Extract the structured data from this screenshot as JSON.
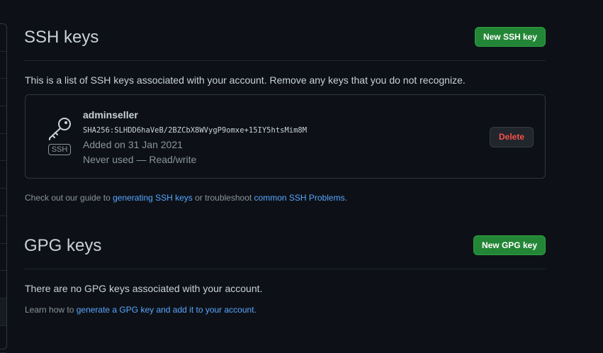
{
  "ssh": {
    "title": "SSH keys",
    "new_button": "New SSH key",
    "description": "This is a list of SSH keys associated with your account. Remove any keys that you do not recognize.",
    "keys": [
      {
        "name": "adminseller",
        "fingerprint": "SHA256:SLHDD6haVeB/2BZCbX8WVygP9omxe+15IY5htsMim8M",
        "added": "Added on 31 Jan 2021",
        "usage": "Never used — Read/write",
        "badge": "SSH",
        "icon": "key-icon",
        "delete_label": "Delete"
      }
    ],
    "guide": {
      "prefix": "Check out our guide to ",
      "link1": "generating SSH keys",
      "middle": " or troubleshoot ",
      "link2": "common SSH Problems",
      "suffix": "."
    }
  },
  "gpg": {
    "title": "GPG keys",
    "new_button": "New GPG key",
    "empty_text": "There are no GPG keys associated with your account.",
    "learn": {
      "prefix": "Learn how to ",
      "link": "generate a GPG key and add it to your account",
      "suffix": "."
    }
  },
  "colors": {
    "background": "#0d1117",
    "primary_button": "#238636",
    "danger_text": "#f85149",
    "link": "#58a6ff"
  }
}
